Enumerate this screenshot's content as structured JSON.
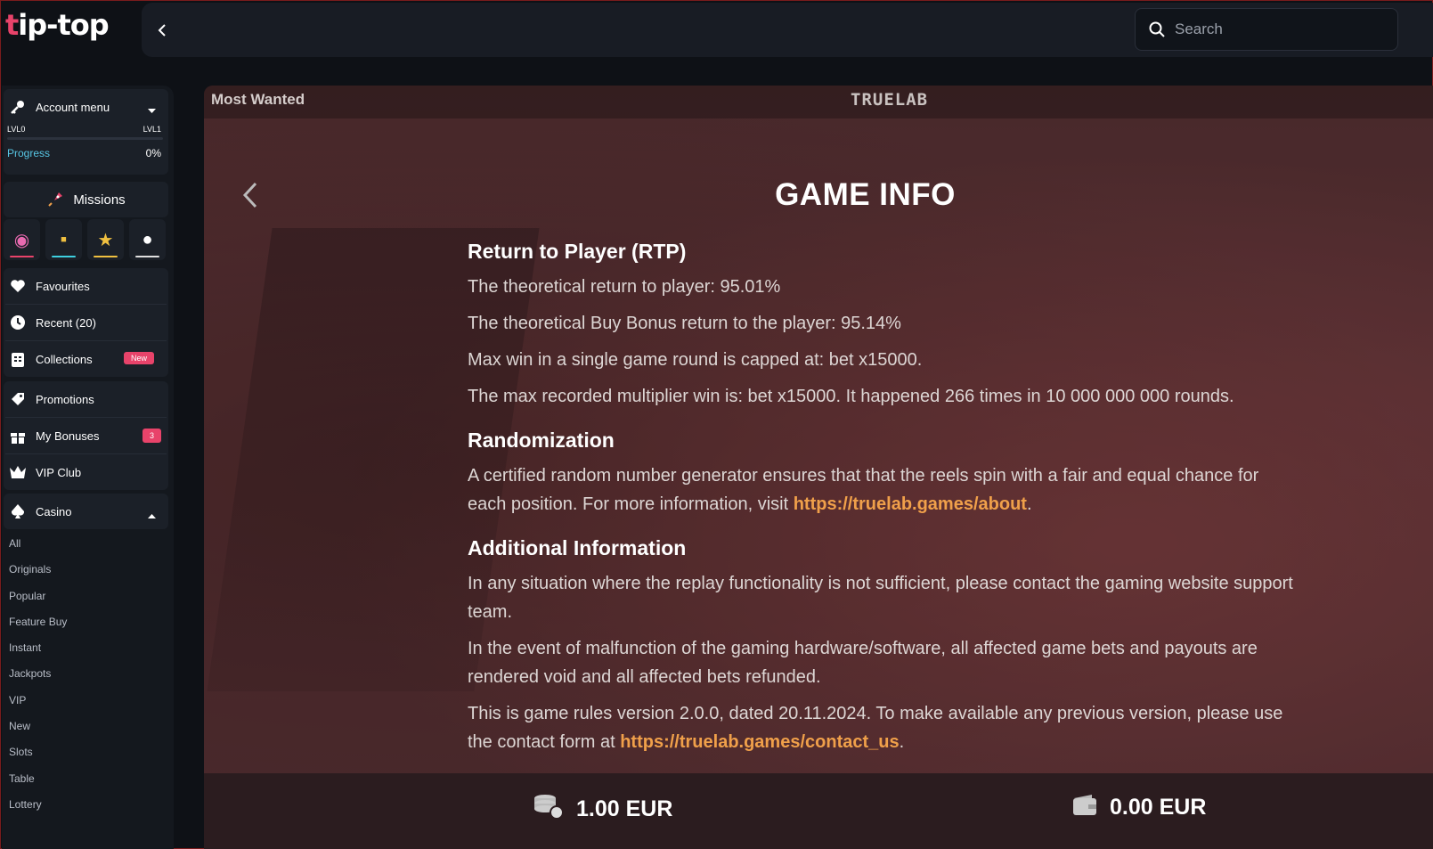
{
  "brand": {
    "logo_prefix": "t",
    "logo_rest": "ip-top"
  },
  "search": {
    "placeholder": "Search"
  },
  "sidebar": {
    "account_menu": "Account menu",
    "level_start": "LVL0",
    "level_end": "LVL1",
    "progress_label": "Progress",
    "progress_value": "0%",
    "missions": "Missions",
    "favourites": "Favourites",
    "recent": "Recent (20)",
    "collections": "Collections",
    "collections_badge": "New",
    "promotions": "Promotions",
    "my_bonuses": "My Bonuses",
    "my_bonuses_badge": "3",
    "vip_club": "VIP Club",
    "casino": "Casino",
    "casino_items": [
      "All",
      "Originals",
      "Popular",
      "Feature Buy",
      "Instant",
      "Jackpots",
      "VIP",
      "New",
      "Slots",
      "Table",
      "Lottery"
    ]
  },
  "game": {
    "title": "Most Wanted",
    "provider": "TRUELAB",
    "heading": "GAME INFO",
    "rtp_heading": "Return to Player (RTP)",
    "rtp_1": "The theoretical return to player: 95.01%",
    "rtp_2": "The theoretical Buy Bonus return to the player: 95.14%",
    "rtp_3": "Max win in a single game round is capped at: bet x15000.",
    "rtp_4": "The max recorded multiplier win is: bet x15000. It happened 266 times in 10 000 000 000 rounds.",
    "rand_heading": "Randomization",
    "rand_text": "A certified random number generator ensures that that the reels spin with a fair and equal chance for each position. For more information, visit ",
    "rand_link": "https://truelab.games/about",
    "rand_end": ".",
    "add_heading": "Additional Information",
    "add_1": "In any situation where the replay functionality is not sufficient, please contact the gaming website support team.",
    "add_2": "In the event of malfunction of the gaming hardware/software, all affected game bets and payouts are rendered void and all affected bets refunded.",
    "add_3": "This is game rules version 2.0.0, dated 20.11.2024. To make available any previous version, please use the contact form at ",
    "add_link": "https://truelab.games/contact_us",
    "add_end": ".",
    "bet": "1.00 EUR",
    "balance": "0.00 EUR"
  },
  "colors": {
    "accent": "#e8436a",
    "link": "#f0a04a",
    "progress_label": "#57c6e4"
  }
}
